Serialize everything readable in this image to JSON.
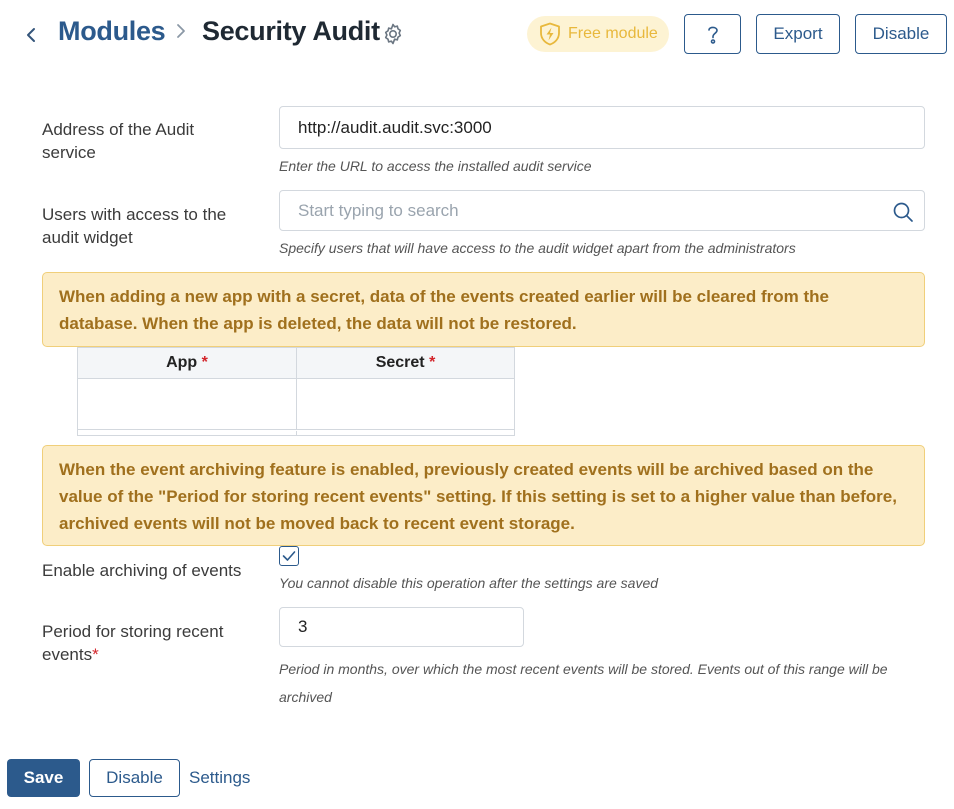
{
  "header": {
    "breadcrumb_parent": "Modules",
    "page_title": "Security Audit",
    "badge_label": "Free module",
    "help_icon": "question-mark-icon",
    "export_label": "Export",
    "disable_label": "Disable"
  },
  "form": {
    "audit_address": {
      "label": "Address of the Audit service",
      "value": "http://audit.audit.svc:3000",
      "hint": "Enter the URL to access the installed audit service"
    },
    "users_access": {
      "label": "Users with access to the audit widget",
      "placeholder": "Start typing to search",
      "hint": "Specify users that will have access to the audit widget apart from the administrators"
    },
    "warning_secret": "When adding a new app with a secret, data of the events created earlier will be cleared from the database. When the app is deleted, the data will not be restored.",
    "table": {
      "columns": [
        {
          "label": "App",
          "required": "*"
        },
        {
          "label": "Secret",
          "required": "*"
        }
      ],
      "rows": [
        [
          "",
          ""
        ]
      ]
    },
    "warning_archiving": "When the event archiving feature is enabled, previously created events will be archived based on the value of the \"Period for storing recent events\" setting. If this setting is set to a higher value than before, archived events will not be moved back to recent event storage.",
    "archiving": {
      "label": "Enable archiving of events",
      "checked": true,
      "hint": "You cannot disable this operation after the settings are saved"
    },
    "period": {
      "label": "Period for storing recent events",
      "required": "*",
      "value": "3",
      "hint": "Period in months, over which the most recent events will be stored. Events out of this range will be archived"
    }
  },
  "footer": {
    "save_label": "Save",
    "disable_label": "Disable",
    "settings_label": "Settings"
  },
  "colors": {
    "brand": "#2c5a8c",
    "warning_bg": "#fcedc8",
    "warning_text": "#a0701d",
    "badge_bg": "#fdf3d3",
    "badge_text": "#e8b83c",
    "required": "#d3252b"
  }
}
